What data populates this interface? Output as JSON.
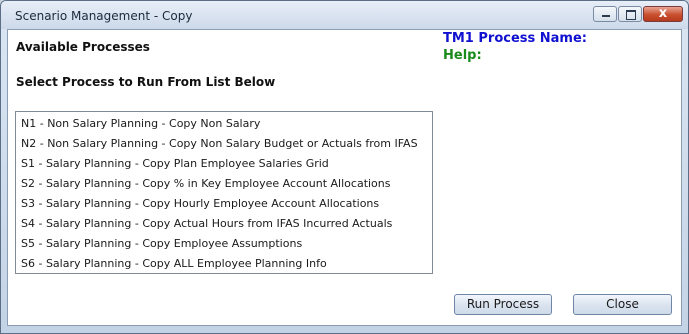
{
  "window": {
    "title": "Scenario Management - Copy",
    "close_glyph": "x"
  },
  "main": {
    "available_heading": "Available Processes",
    "select_heading": "Select Process to Run From List Below",
    "tm1_process_name_label": "TM1 Process Name:",
    "help_label": "Help:",
    "processes": [
      "N1 - Non Salary Planning - Copy Non Salary",
      "N2 - Non Salary Planning - Copy Non Salary Budget or Actuals from IFAS",
      "S1 - Salary Planning - Copy Plan Employee Salaries Grid",
      "S2 - Salary Planning - Copy % in Key Employee Account Allocations",
      "S3 - Salary Planning - Copy Hourly Employee Account Allocations",
      "S4 - Salary Planning - Copy Actual Hours from IFAS Incurred Actuals",
      "S5 - Salary Planning - Copy Employee Assumptions",
      "S6 - Salary Planning - Copy ALL Employee Planning Info"
    ]
  },
  "buttons": {
    "run_process": "Run Process",
    "close": "Close"
  },
  "colors": {
    "tm1_label": "#1010d0",
    "help_label": "#1a8a1a"
  }
}
